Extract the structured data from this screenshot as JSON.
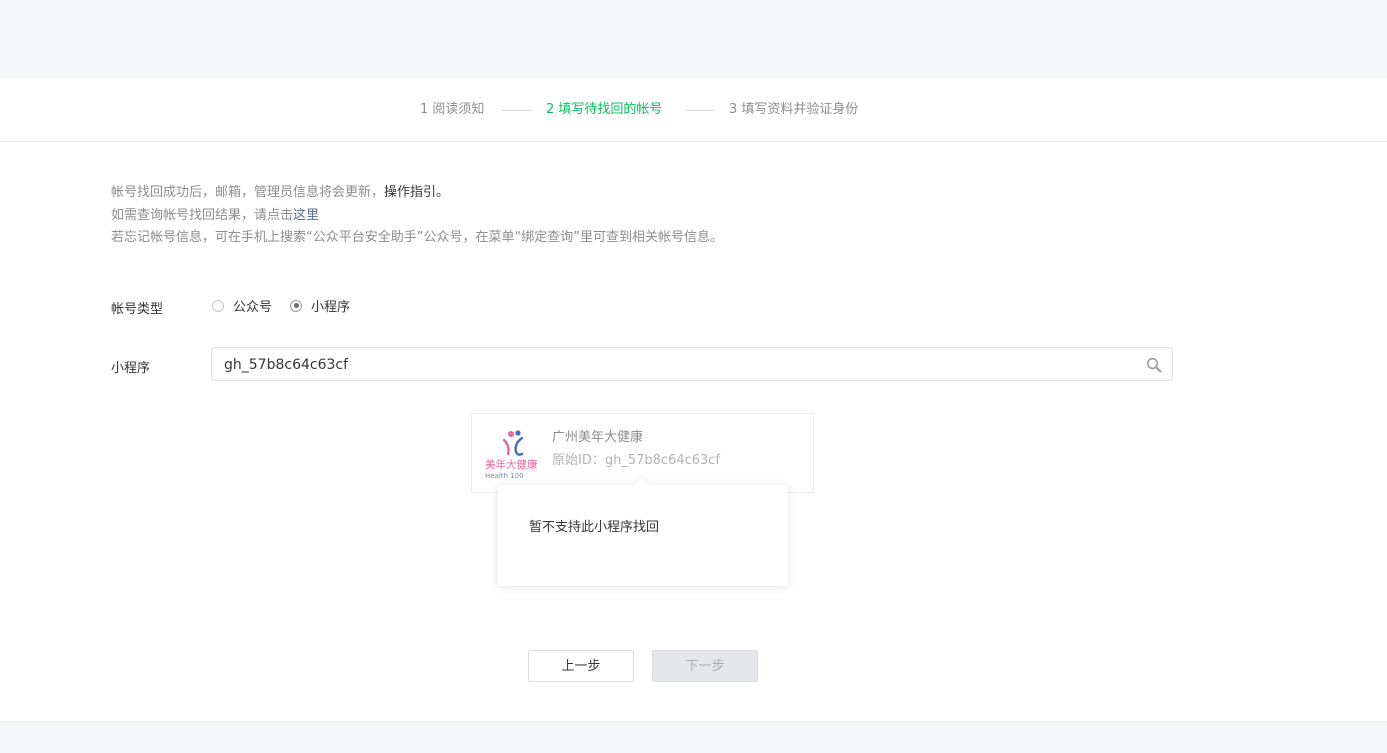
{
  "steps": [
    {
      "label": "1 阅读须知",
      "active": false
    },
    {
      "label": "2 填写待找回的帐号",
      "active": true
    },
    {
      "label": "3 填写资料并验证身份",
      "active": false
    }
  ],
  "notice": {
    "line1_prefix": "帐号找回成功后，邮箱，管理员信息将会更新，",
    "line1_link": "操作指引。",
    "line2_prefix": "如需查询帐号找回结果，请点击",
    "line2_link": "这里",
    "line3": "若忘记帐号信息，可在手机上搜索“公众平台安全助手”公众号，在菜单“绑定查询”里可查到相关帐号信息。"
  },
  "form": {
    "type_label": "帐号类型",
    "options": [
      {
        "label": "公众号",
        "checked": false
      },
      {
        "label": "小程序",
        "checked": true
      }
    ],
    "input_label": "小程序",
    "input_value": "gh_57b8c64c63cf"
  },
  "result": {
    "name": "广州美年大健康",
    "original_id": "原始ID：gh_57b8c64c63cf",
    "logo_text": "美年大健康",
    "logo_subtext": "Health 100"
  },
  "popover": {
    "message": "暂不支持此小程序找回"
  },
  "buttons": {
    "prev": "上一步",
    "next": "下一步"
  },
  "colors": {
    "active_step": "#07c160",
    "link": "#576b95",
    "background": "#f6f7f9"
  }
}
